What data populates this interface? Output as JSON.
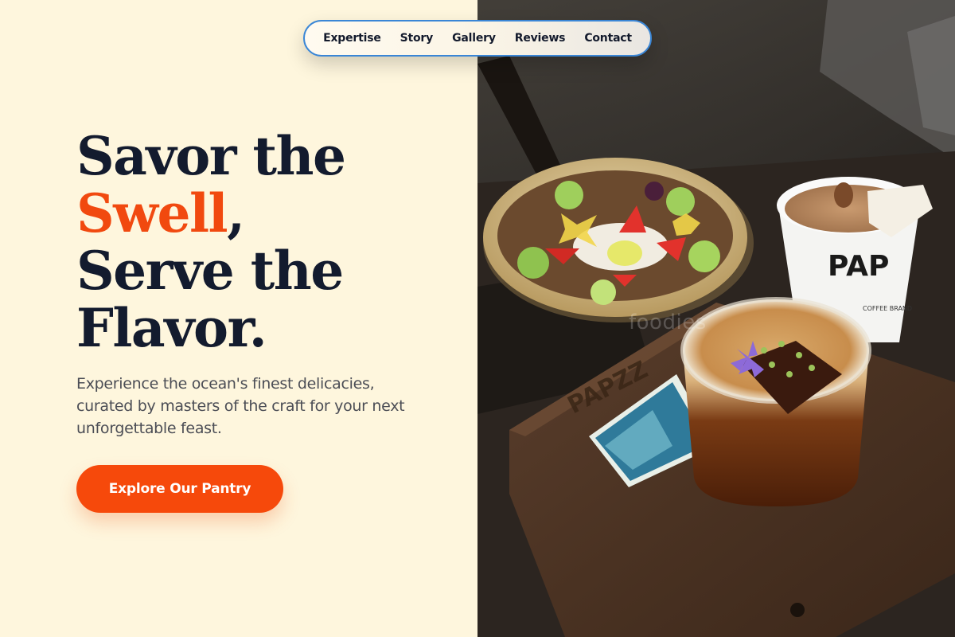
{
  "nav": {
    "items": [
      "Expertise",
      "Story",
      "Gallery",
      "Reviews",
      "Contact"
    ]
  },
  "hero": {
    "headline_line1": "Savor the",
    "headline_accent": "Swell",
    "headline_comma": ",",
    "headline_line3": "Serve the",
    "headline_line4": "Flavor.",
    "subtext": "Experience the ocean's finest delicacies, curated by masters of the craft for your next unforgettable feast.",
    "cta_label": "Explore Our Pantry"
  },
  "photo": {
    "cup_brand": "PAP",
    "cup_sub": "COFFEE BRAND",
    "board_engraving": "PAPZZ",
    "watermark": "foodies"
  },
  "colors": {
    "accent": "#f1490f",
    "heading": "#131b2e",
    "background": "#fef6dd",
    "nav_border": "#3a86d6"
  }
}
